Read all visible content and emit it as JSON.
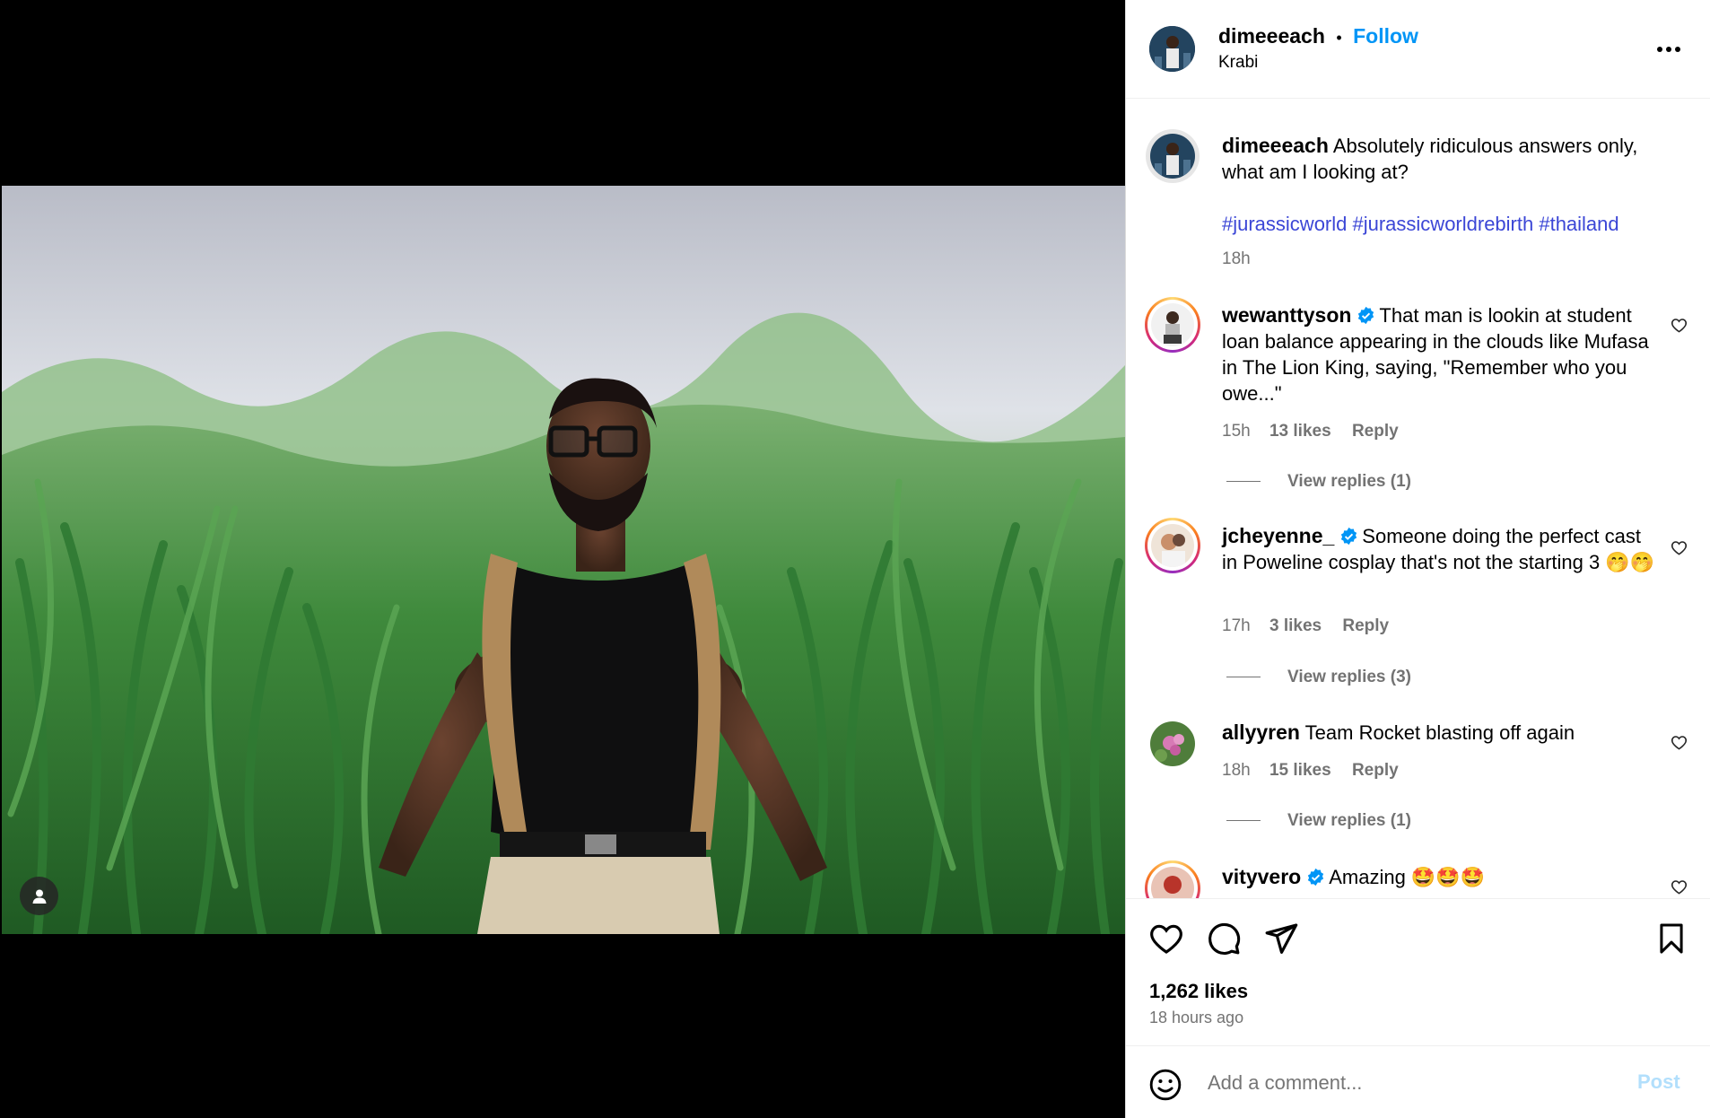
{
  "header": {
    "username": "dimeeeach",
    "separator": "•",
    "follow_label": "Follow",
    "location": "Krabi",
    "more_icon": "more-options-icon"
  },
  "caption": {
    "username": "dimeeeach",
    "text": "Absolutely ridiculous answers only, what am I looking at?",
    "hashtags": "#jurassicworld #jurassicworldrebirth #thailand",
    "time": "18h"
  },
  "comments": [
    {
      "username": "wewanttyson",
      "verified": true,
      "text": "That man is lookin at student loan balance appearing in the clouds like Mufasa in The Lion King, saying, \"Remember who you owe...\"",
      "time": "15h",
      "likes": "13 likes",
      "reply_label": "Reply",
      "view_replies": "View replies (1)"
    },
    {
      "username": "jcheyenne_",
      "verified": true,
      "text": "Someone doing the perfect cast in Poweline cosplay that's not the starting 3 🤭🤭",
      "time": "17h",
      "likes": "3 likes",
      "reply_label": "Reply",
      "view_replies": "View replies (3)"
    },
    {
      "username": "allyyren",
      "verified": false,
      "text": "Team Rocket blasting off again",
      "time": "18h",
      "likes": "15 likes",
      "reply_label": "Reply",
      "view_replies": "View replies (1)"
    },
    {
      "username": "vityvero",
      "verified": true,
      "text": "Amazing 🤩🤩🤩"
    }
  ],
  "actions": {
    "likes_count": "1,262 likes",
    "time_ago": "18 hours ago"
  },
  "composer": {
    "placeholder": "Add a comment...",
    "post_label": "Post"
  },
  "colors": {
    "accent_blue": "#0095f6",
    "hashtag_blue": "#3b46d6",
    "secondary_text": "#737373",
    "post_disabled": "#b2dffc"
  }
}
